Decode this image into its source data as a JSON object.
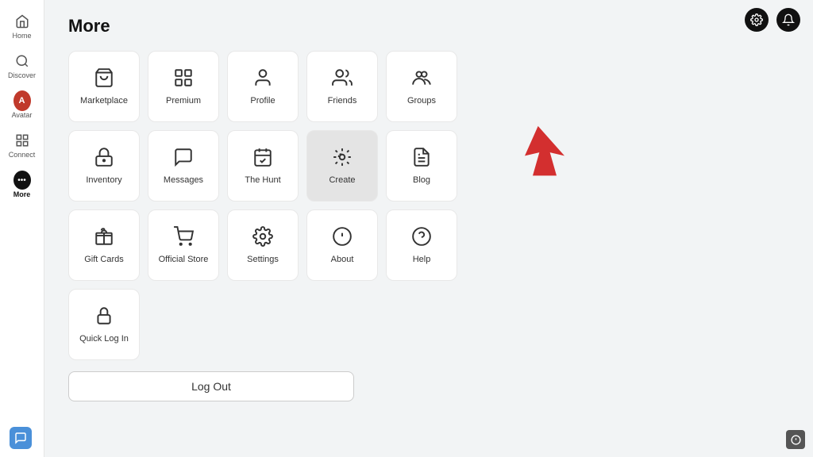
{
  "page": {
    "title": "More"
  },
  "sidebar": {
    "items": [
      {
        "id": "home",
        "label": "Home",
        "icon": "⌂"
      },
      {
        "id": "discover",
        "label": "Discover",
        "icon": "◎"
      },
      {
        "id": "avatar",
        "label": "Avatar",
        "icon": "avatar"
      },
      {
        "id": "connect",
        "label": "Connect",
        "icon": "▣"
      },
      {
        "id": "more",
        "label": "More",
        "icon": "more",
        "active": true
      }
    ]
  },
  "grid": {
    "rows": [
      [
        {
          "id": "marketplace",
          "label": "Marketplace",
          "icon": "🛍",
          "highlighted": false
        },
        {
          "id": "premium",
          "label": "Premium",
          "icon": "▦",
          "highlighted": false
        },
        {
          "id": "profile",
          "label": "Profile",
          "icon": "👤",
          "highlighted": false
        },
        {
          "id": "friends",
          "label": "Friends",
          "icon": "👥",
          "highlighted": false
        },
        {
          "id": "groups",
          "label": "Groups",
          "icon": "👥",
          "highlighted": false
        }
      ],
      [
        {
          "id": "inventory",
          "label": "Inventory",
          "icon": "🔒",
          "highlighted": false
        },
        {
          "id": "messages",
          "label": "Messages",
          "icon": "💬",
          "highlighted": false
        },
        {
          "id": "thehunt",
          "label": "The Hunt",
          "icon": "📅",
          "highlighted": false
        },
        {
          "id": "create",
          "label": "Create",
          "icon": "⚙",
          "highlighted": true
        },
        {
          "id": "blog",
          "label": "Blog",
          "icon": "📰",
          "highlighted": false
        }
      ],
      [
        {
          "id": "giftcards",
          "label": "Gift Cards",
          "icon": "🎁",
          "highlighted": false
        },
        {
          "id": "officialstore",
          "label": "Official Store",
          "icon": "🛒",
          "highlighted": false
        },
        {
          "id": "settings",
          "label": "Settings",
          "icon": "⚙",
          "highlighted": false
        },
        {
          "id": "about",
          "label": "About",
          "icon": "ℹ",
          "highlighted": false
        },
        {
          "id": "help",
          "label": "Help",
          "icon": "❓",
          "highlighted": false
        }
      ],
      [
        {
          "id": "quicklogin",
          "label": "Quick Log In",
          "icon": "🔐",
          "highlighted": false
        }
      ]
    ]
  },
  "logout": {
    "label": "Log Out"
  },
  "topRight": {
    "settingsIcon": "⚙",
    "notificationIcon": "🔔"
  }
}
